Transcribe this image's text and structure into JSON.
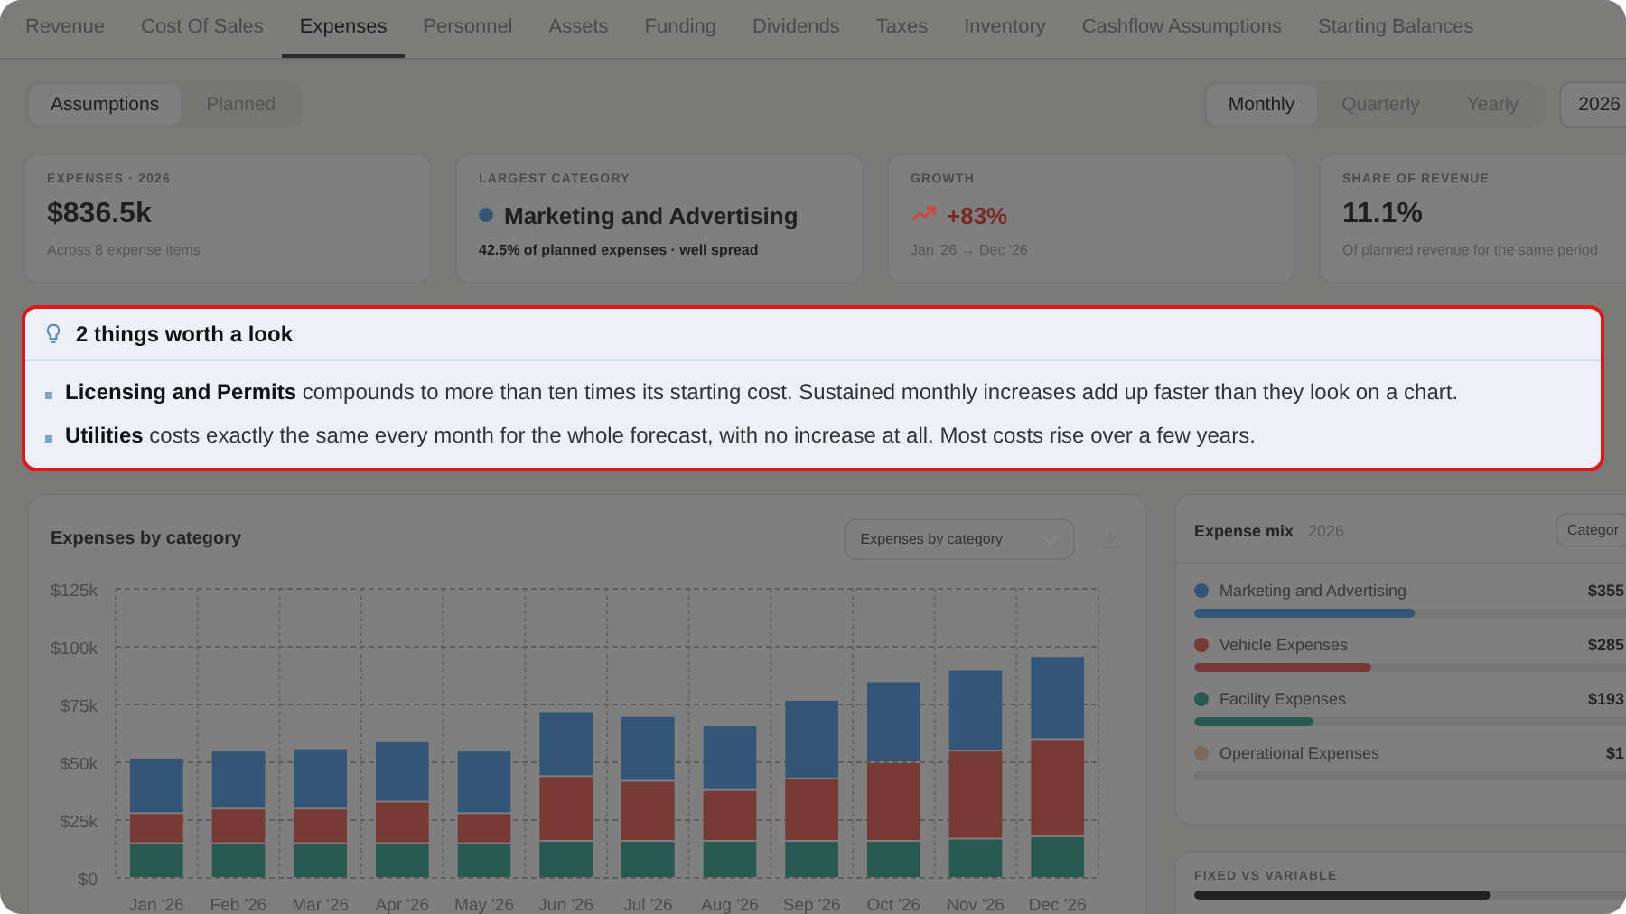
{
  "tabs": [
    {
      "label": "Revenue",
      "selected": false
    },
    {
      "label": "Cost Of Sales",
      "selected": false
    },
    {
      "label": "Expenses",
      "selected": true
    },
    {
      "label": "Personnel",
      "selected": false
    },
    {
      "label": "Assets",
      "selected": false
    },
    {
      "label": "Funding",
      "selected": false
    },
    {
      "label": "Dividends",
      "selected": false
    },
    {
      "label": "Taxes",
      "selected": false
    },
    {
      "label": "Inventory",
      "selected": false
    },
    {
      "label": "Cashflow Assumptions",
      "selected": false
    },
    {
      "label": "Starting Balances",
      "selected": false
    }
  ],
  "view_toggle": [
    {
      "label": "Assumptions",
      "selected": true
    },
    {
      "label": "Planned",
      "selected": false
    }
  ],
  "period_toggle": [
    {
      "label": "Monthly",
      "selected": true
    },
    {
      "label": "Quarterly",
      "selected": false
    },
    {
      "label": "Yearly",
      "selected": false
    }
  ],
  "year_select": {
    "value": "2026"
  },
  "cards": [
    {
      "kind": "total",
      "label": "EXPENSES · 2026",
      "value": "$836.5k",
      "note": "Across 8 expense items"
    },
    {
      "kind": "category",
      "label": "LARGEST CATEGORY",
      "value": "Marketing and Advertising",
      "color": "#345676",
      "note": "42.5% of planned expenses · well spread"
    },
    {
      "kind": "growth",
      "label": "GROWTH",
      "value": "+83%",
      "note": "Jan '26 → Dec '26"
    },
    {
      "kind": "total",
      "label": "SHARE OF REVENUE",
      "value": "11.1%",
      "note": "Of planned revenue for the same period"
    }
  ],
  "callout": {
    "title": "2 things worth a look",
    "items": [
      "**Licensing and Permits** compounds to more than ten times its starting cost. Sustained monthly increases add up faster than they look on a chart.",
      "**Utilities** costs exactly the same every month for the whole forecast, with no increase at all. Most costs rise over a few years."
    ]
  },
  "chart_panel": {
    "title": "Expenses by category",
    "select": "Expenses by category",
    "chart_data": {
      "type": "bar",
      "stacked": true,
      "grid": true,
      "categories": [
        "Jan '26",
        "Feb '26",
        "Mar '26",
        "Apr '26",
        "May '26",
        "Jun '26",
        "Jul '26",
        "Aug '26",
        "Sep '26",
        "Oct '26",
        "Nov '26",
        "Dec '26"
      ],
      "ylim": [
        0,
        125
      ],
      "yticks": [
        {
          "value": 0,
          "label": "$0"
        },
        {
          "value": 25,
          "label": "$25k"
        },
        {
          "value": 50,
          "label": "$50k"
        },
        {
          "value": 75,
          "label": "$75k"
        },
        {
          "value": 100,
          "label": "$100k"
        },
        {
          "value": 125,
          "label": "$125k"
        }
      ],
      "series": [
        {
          "color": "#285a52",
          "values": [
            15,
            15,
            15,
            15,
            15,
            16,
            16,
            16,
            16,
            16,
            17,
            18
          ]
        },
        {
          "color": "#773a35",
          "values": [
            13,
            15,
            15,
            18,
            13,
            28,
            26,
            22,
            27,
            34,
            38,
            42
          ]
        },
        {
          "color": "#345676",
          "values": [
            24,
            25,
            26,
            26,
            27,
            28,
            28,
            28,
            34,
            35,
            35,
            36
          ]
        }
      ]
    }
  },
  "expense_mix": {
    "title": "Expense mix",
    "year": "2026",
    "button": "Categor",
    "items": [
      {
        "name": "Marketing and Advertising",
        "color": "#345676",
        "amount": "$355",
        "level": 0.425
      },
      {
        "name": "Vehicle Expenses",
        "color": "#773a35",
        "amount": "$285",
        "level": 0.34
      },
      {
        "name": "Facility Expenses",
        "color": "#285a52",
        "amount": "$193",
        "level": 0.23
      },
      {
        "name": "Operational Expenses",
        "color": "#78685e",
        "amount": "$1",
        "level": 0.005
      }
    ]
  },
  "fixed_vs_variable": {
    "label": "FIXED VS VARIABLE",
    "level": 0.57
  }
}
